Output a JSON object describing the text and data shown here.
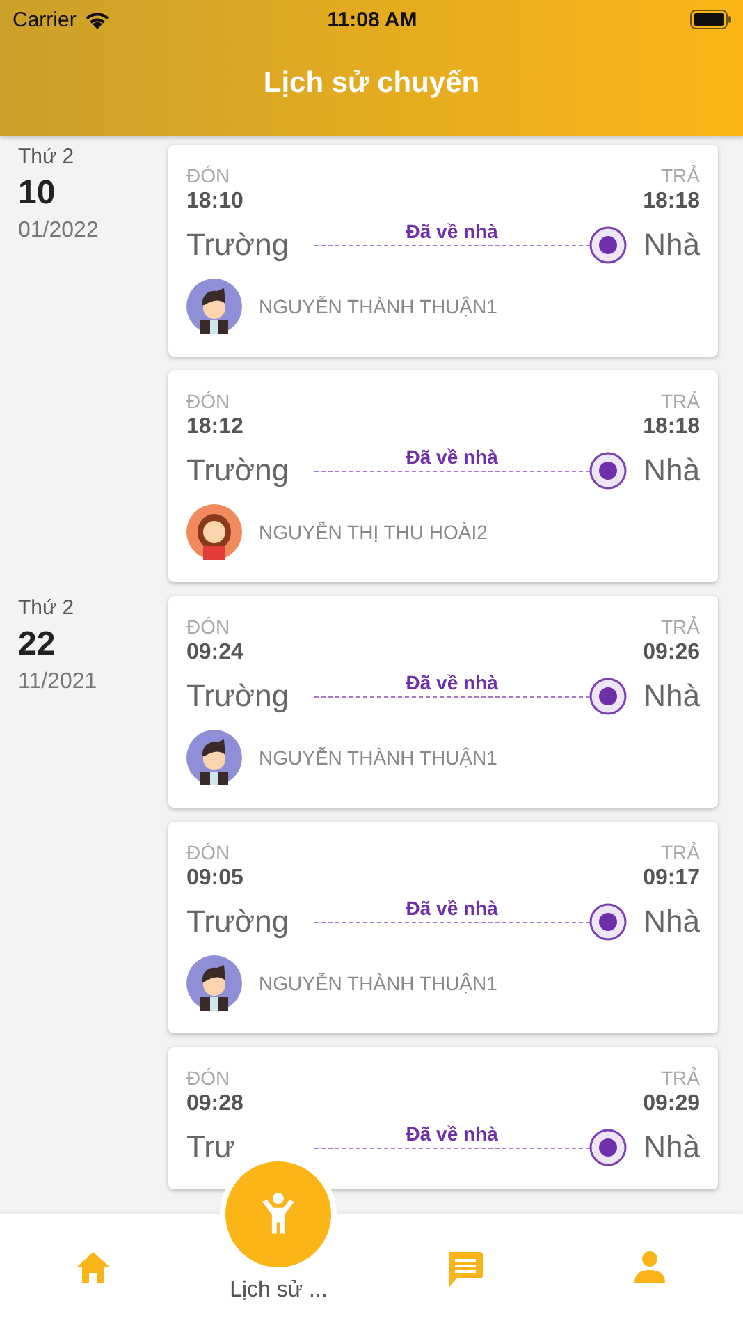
{
  "status_bar": {
    "carrier": "Carrier",
    "time": "11:08 AM"
  },
  "header": {
    "title": "Lịch sử chuyến"
  },
  "days": [
    {
      "weekday": "Thứ 2",
      "day": "10",
      "month_year": "01/2022",
      "trips": [
        {
          "pickup_label": "ĐÓN",
          "pickup_time": "18:10",
          "dropoff_label": "TRẢ",
          "dropoff_time": "18:18",
          "from": "Trường",
          "to": "Nhà",
          "status": "Đã về nhà",
          "child": {
            "name": "NGUYỄN THÀNH THUẬN1",
            "kind": "boy"
          }
        },
        {
          "pickup_label": "ĐÓN",
          "pickup_time": "18:12",
          "dropoff_label": "TRẢ",
          "dropoff_time": "18:18",
          "from": "Trường",
          "to": "Nhà",
          "status": "Đã về nhà",
          "child": {
            "name": "NGUYỄN THỊ THU HOÀI2",
            "kind": "girl"
          }
        }
      ]
    },
    {
      "weekday": "Thứ 2",
      "day": "22",
      "month_year": "11/2021",
      "trips": [
        {
          "pickup_label": "ĐÓN",
          "pickup_time": "09:24",
          "dropoff_label": "TRẢ",
          "dropoff_time": "09:26",
          "from": "Trường",
          "to": "Nhà",
          "status": "Đã về nhà",
          "child": {
            "name": "NGUYỄN THÀNH THUẬN1",
            "kind": "boy"
          }
        },
        {
          "pickup_label": "ĐÓN",
          "pickup_time": "09:05",
          "dropoff_label": "TRẢ",
          "dropoff_time": "09:17",
          "from": "Trường",
          "to": "Nhà",
          "status": "Đã về nhà",
          "child": {
            "name": "NGUYỄN THÀNH THUẬN1",
            "kind": "boy"
          }
        },
        {
          "pickup_label": "ĐÓN",
          "pickup_time": "09:28",
          "dropoff_label": "TRẢ",
          "dropoff_time": "09:29",
          "from": "Trư",
          "to": "Nhà",
          "status": "Đã về nhà"
        }
      ]
    }
  ],
  "tab_bar": [
    {
      "kind": "home",
      "selected": false
    },
    {
      "kind": "history",
      "label": "Lịch sử ...",
      "selected": true
    },
    {
      "kind": "messages",
      "selected": false
    },
    {
      "kind": "profile",
      "selected": false
    }
  ]
}
